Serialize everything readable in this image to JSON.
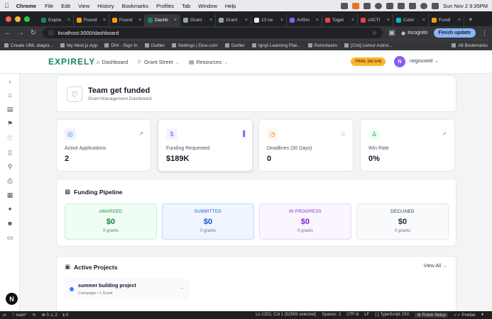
{
  "os_menubar": {
    "app_name": "Chrome",
    "items": [
      "File",
      "Edit",
      "View",
      "History",
      "Bookmarks",
      "Profiles",
      "Tab",
      "Window",
      "Help"
    ],
    "clock": "Sun Nov 2  9:35PM"
  },
  "browser": {
    "tabs": [
      {
        "title": "Expire",
        "color": "#16855f",
        "active": false
      },
      {
        "title": "Found",
        "color": "#f59e0b",
        "active": false
      },
      {
        "title": "Found",
        "color": "#f59e0b",
        "active": false
      },
      {
        "title": "Dashb",
        "color": "#16855f",
        "active": true
      },
      {
        "title": "Grant",
        "color": "#9aa0a6",
        "active": false
      },
      {
        "title": "Grant",
        "color": "#9aa0a6",
        "active": false
      },
      {
        "title": "13 ne",
        "color": "#e8eaed",
        "active": false
      },
      {
        "title": "ArtSm",
        "color": "#8b5cf6",
        "active": false
      },
      {
        "title": "Toget",
        "color": "#ef4444",
        "active": false
      },
      {
        "title": "s3CTI",
        "color": "#ef4444",
        "active": false
      },
      {
        "title": "Color",
        "color": "#06b6d4",
        "active": false
      },
      {
        "title": "Fundi",
        "color": "#f59e0b",
        "active": false
      }
    ],
    "url": "localhost:3000/dashboard",
    "incognito_label": "Incognito",
    "finish_update_label": "Finish update",
    "bookmarks": [
      "Create UML diagra...",
      "My Next.js App",
      "DHI - Sign In",
      "Outlier",
      "Settings | Dice.com",
      "Outlier",
      "Ignyt Learning Plat...",
      "Remotasks",
      "[Clst] Lemur Astrol..."
    ],
    "all_bookmarks_label": "All Bookmarks"
  },
  "app_header": {
    "logo": "EXPIRELY",
    "nav": [
      {
        "label": "Dashboard",
        "icon": "home-icon",
        "has_dropdown": false
      },
      {
        "label": "Grant Street",
        "icon": "bank-icon",
        "has_dropdown": true
      },
      {
        "label": "Resources",
        "icon": "book-icon",
        "has_dropdown": true
      }
    ],
    "trial_badge": "TRIAL (9d left)",
    "user_initial": "N",
    "username": "negouseid"
  },
  "sidebar": {
    "icons": [
      "chevron-right-icon",
      "home-icon",
      "book-open-icon",
      "bank-icon",
      "heart-icon",
      "folder-icon",
      "search-icon",
      "bookmark-icon",
      "calendar-icon",
      "sparkles-icon",
      "users-icon",
      "folder-alt-icon"
    ],
    "bottom_badge": "N"
  },
  "page": {
    "title": "Team get funded",
    "subtitle": "Grant Management Dashboard"
  },
  "stats": [
    {
      "label": "Active Applications",
      "value": "2",
      "icon": "target-icon",
      "trend_icon": "trend-up-icon",
      "color": "#3b82f6",
      "bg": "#eef2ff"
    },
    {
      "label": "Funding Requested",
      "value": "$189K",
      "icon": "dollar-icon",
      "trend_icon": "bar-chart-icon",
      "color": "#8b5cf6",
      "bg": "#f5f3ff"
    },
    {
      "label": "Deadlines (30 Days)",
      "value": "0",
      "icon": "clock-icon",
      "trend_icon": "flame-icon",
      "color": "#f97316",
      "bg": "#fff7ed"
    },
    {
      "label": "Win Rate",
      "value": "0%",
      "icon": "award-icon",
      "trend_icon": "check-circle-icon",
      "color": "#16a34a",
      "bg": "#f0fdf4"
    }
  ],
  "pipeline": {
    "title": "Funding Pipeline",
    "stages": [
      {
        "label": "AWARDED",
        "amount": "$0",
        "count": "0 grants",
        "color": "#15803d",
        "bg": "#f0fdf4",
        "border": "#bbf7d0"
      },
      {
        "label": "SUBMITTED",
        "amount": "$0",
        "count": "0 grants",
        "color": "#1d4ed8",
        "bg": "#eff6ff",
        "border": "#bfdbfe"
      },
      {
        "label": "IN PROGRESS",
        "amount": "$0",
        "count": "0 grants",
        "color": "#7e22ce",
        "bg": "#faf5ff",
        "border": "#e9d5ff"
      },
      {
        "label": "DECLINED",
        "amount": "$0",
        "count": "0 grants",
        "color": "#1f2937",
        "bg": "#f9fafb",
        "border": "#e5e7eb"
      }
    ]
  },
  "projects": {
    "title": "Active Projects",
    "view_all": "View All",
    "items": [
      {
        "name": "summer building project",
        "meta": "Campaign • 1 Grant"
      }
    ]
  },
  "statusbar": {
    "branch": "main*",
    "problems": "0 ⚠ 2",
    "warnings": "0",
    "position": "Ln 1202, Col 1 (52593 selected)",
    "spaces": "Spaces: 2",
    "encoding": "UTF-8",
    "eol": "LF",
    "language": "TypeScript JSX",
    "finish_setup": "Finish Setup",
    "prettier": "Prettier"
  }
}
